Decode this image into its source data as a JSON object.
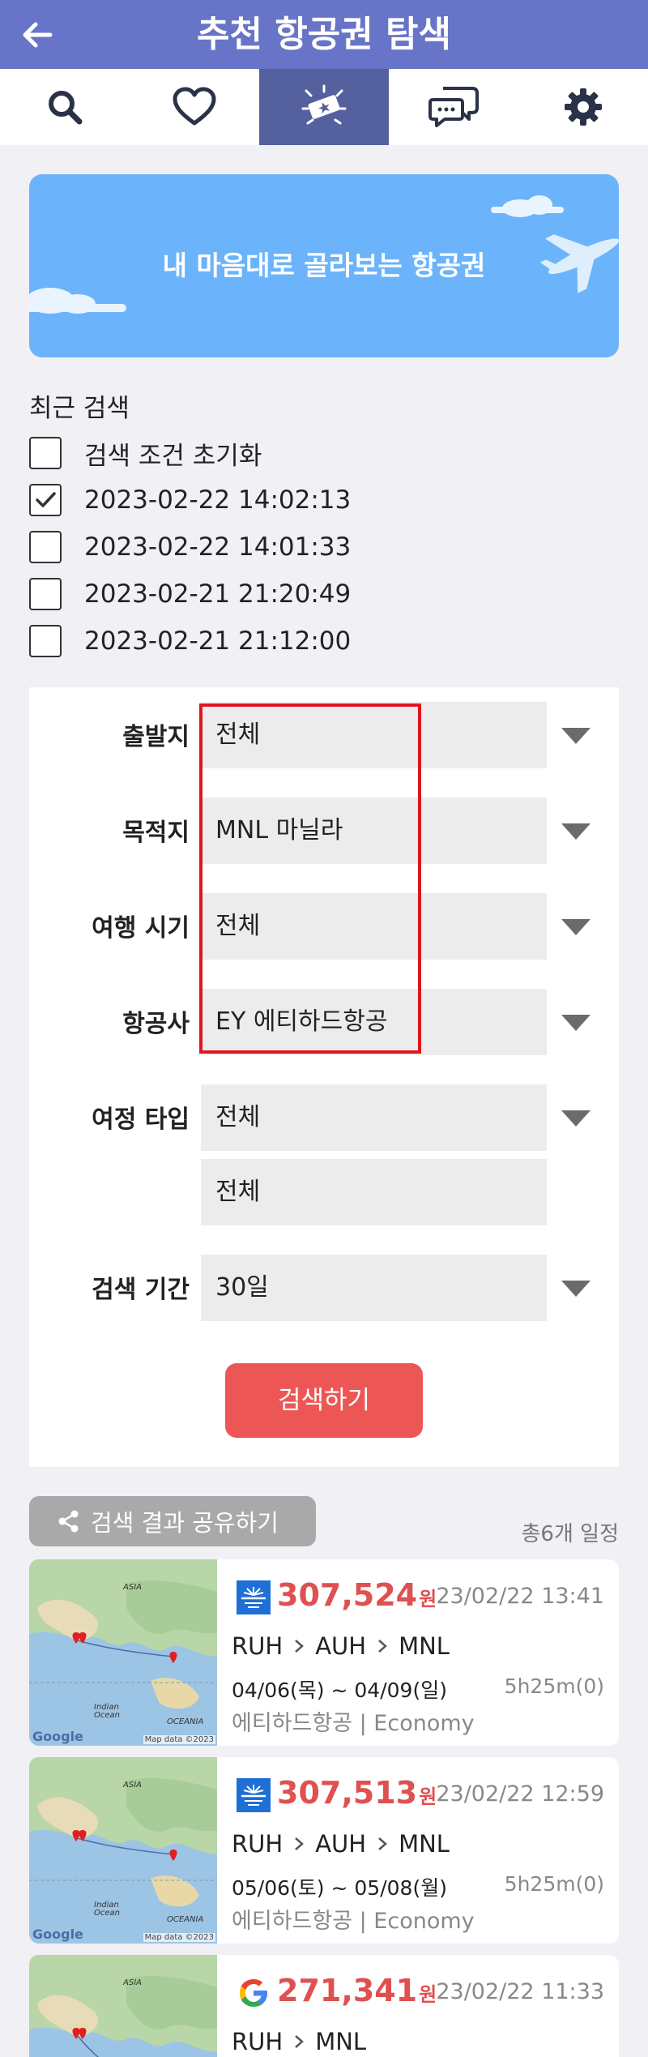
{
  "header": {
    "title": "추천 항공권 탐색",
    "back_icon": "back-arrow-icon"
  },
  "tabs": [
    {
      "name": "search",
      "icon": "search-icon",
      "active": false
    },
    {
      "name": "favorites",
      "icon": "heart-icon",
      "active": false
    },
    {
      "name": "recommend",
      "icon": "ticket-sparkle-icon",
      "active": true
    },
    {
      "name": "chat",
      "icon": "chat-bubbles-icon",
      "active": false
    },
    {
      "name": "settings",
      "icon": "gear-icon",
      "active": false
    }
  ],
  "banner": {
    "text": "내 마음대로 골라보는 항공권"
  },
  "recent": {
    "title": "최근 검색",
    "items": [
      {
        "label": "검색 조건 초기화",
        "checked": false
      },
      {
        "label": "2023-02-22 14:02:13",
        "checked": true
      },
      {
        "label": "2023-02-22 14:01:33",
        "checked": false
      },
      {
        "label": "2023-02-21 21:20:49",
        "checked": false
      },
      {
        "label": "2023-02-21 21:12:00",
        "checked": false
      }
    ]
  },
  "form": {
    "departure": {
      "label": "출발지",
      "value": "전체"
    },
    "destination": {
      "label": "목적지",
      "value": "MNL 마닐라"
    },
    "travel_time": {
      "label": "여행 시기",
      "value": "전체"
    },
    "airline": {
      "label": "항공사",
      "value": "EY 에티하드항공"
    },
    "trip_type": {
      "label": "여정 타입",
      "value": "전체",
      "value2": "전체"
    },
    "search_period": {
      "label": "검색 기간",
      "value": "30일"
    },
    "search_button": "검색하기"
  },
  "results": {
    "share_label": "검색 결과 공유하기",
    "total": "총6개 일정",
    "currency": "원",
    "map_labels": {
      "asia": "ASIA",
      "indian": "Indian\nOcean",
      "oceania": "OCEANIA",
      "data": "Map data ©2023",
      "google": "Google"
    },
    "cards": [
      {
        "airline_icon": "etihad-logo-icon",
        "price": "307,524",
        "date": "23/02/22 13:41",
        "route": [
          "RUH",
          "AUH",
          "MNL"
        ],
        "period": "04/06(목) ~ 04/09(일)",
        "duration": "5h25m(0)",
        "carrier": "에티하드항공 | Economy"
      },
      {
        "airline_icon": "etihad-logo-icon",
        "price": "307,513",
        "date": "23/02/22 12:59",
        "route": [
          "RUH",
          "AUH",
          "MNL"
        ],
        "period": "05/06(토) ~ 05/08(월)",
        "duration": "5h25m(0)",
        "carrier": "에티하드항공 | Economy"
      },
      {
        "airline_icon": "google-logo-icon",
        "price": "271,341",
        "date": "23/02/22 11:33",
        "route": [
          "RUH",
          "MNL"
        ],
        "period": "",
        "duration": "",
        "carrier": ""
      }
    ]
  },
  "colors": {
    "header": "#6774c7",
    "active_tab": "#55609e",
    "banner": "#6bb4fb",
    "price": "#e05050",
    "button": "#ec5755",
    "highlight": "#e0161f"
  }
}
